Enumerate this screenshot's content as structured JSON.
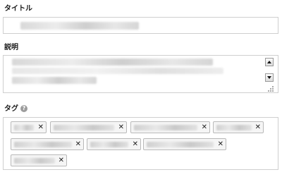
{
  "form": {
    "title_label": "タイトル",
    "description_label": "説明",
    "tags_label": "タグ",
    "help_icon": "question-circle-icon",
    "help_glyph": "?"
  },
  "tags": [
    {
      "remove_glyph": "✕"
    },
    {
      "remove_glyph": "✕"
    },
    {
      "remove_glyph": "✕"
    },
    {
      "remove_glyph": "✕"
    },
    {
      "remove_glyph": "✕"
    },
    {
      "remove_glyph": "✕"
    },
    {
      "remove_glyph": "✕"
    },
    {
      "remove_glyph": "✕"
    }
  ],
  "colors": {
    "border": "#cfcfcf",
    "tag_bg": "#f5f5f5",
    "tag_border": "#b9b9b9"
  }
}
